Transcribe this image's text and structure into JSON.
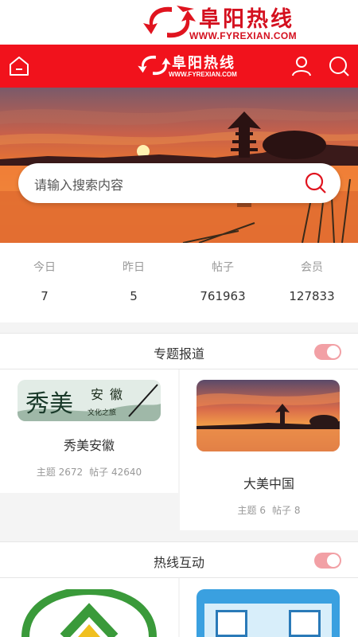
{
  "brand": {
    "name_cn": "阜阳热线",
    "domain": "WWW.FYREXIAN.COM"
  },
  "navbar": {
    "home_icon": "home-icon",
    "user_icon": "user-icon",
    "search_icon": "search-icon",
    "color": "#f1121c"
  },
  "search": {
    "placeholder": "请输入搜索内容"
  },
  "stats": [
    {
      "label": "今日",
      "value": "7"
    },
    {
      "label": "昨日",
      "value": "5"
    },
    {
      "label": "帖子",
      "value": "761963"
    },
    {
      "label": "会员",
      "value": "127833"
    }
  ],
  "sections": [
    {
      "title": "专题报道",
      "cards": [
        {
          "name": "秀美安徽",
          "topics": "主题 2672",
          "posts": "帖子 42640",
          "image_text": {
            "big": "秀美",
            "mid": "安徽",
            "small": "文化之旅"
          }
        },
        {
          "name": "大美中国",
          "topics": "主题 6",
          "posts": "帖子 8"
        }
      ]
    },
    {
      "title": "热线互动"
    }
  ]
}
